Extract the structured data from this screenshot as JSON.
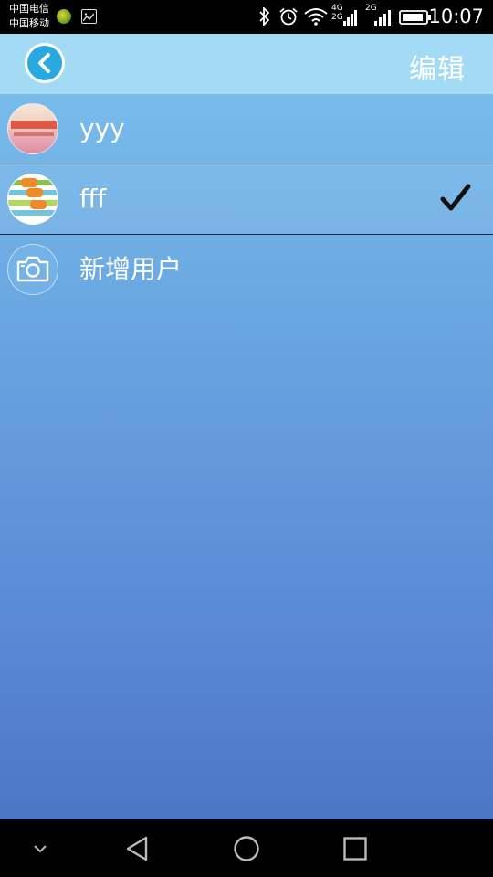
{
  "status_bar": {
    "carrier_1": "中国电信",
    "carrier_2": "中国移动",
    "network_4g": "4G",
    "network_2g_a": "2G",
    "network_2g_b": "2G",
    "time": "10:07",
    "icons": [
      "app-notification-icon",
      "gallery-icon",
      "bluetooth-icon",
      "alarm-icon",
      "wifi-icon",
      "signal-icon",
      "signal-icon",
      "battery-icon"
    ]
  },
  "header": {
    "back_icon": "chevron-left-circle-icon",
    "edit_label": "编辑"
  },
  "users": [
    {
      "name": "yyy",
      "selected": false
    },
    {
      "name": "fff",
      "selected": true
    }
  ],
  "add_user": {
    "label": "新增用户",
    "icon": "camera-icon"
  },
  "nav_bar": {
    "icons": [
      "collapse-icon",
      "back-triangle-icon",
      "home-circle-icon",
      "recents-square-icon"
    ]
  },
  "colors": {
    "header": "#a3daf4",
    "accent": "#2aa9e0",
    "check": "#111111"
  }
}
